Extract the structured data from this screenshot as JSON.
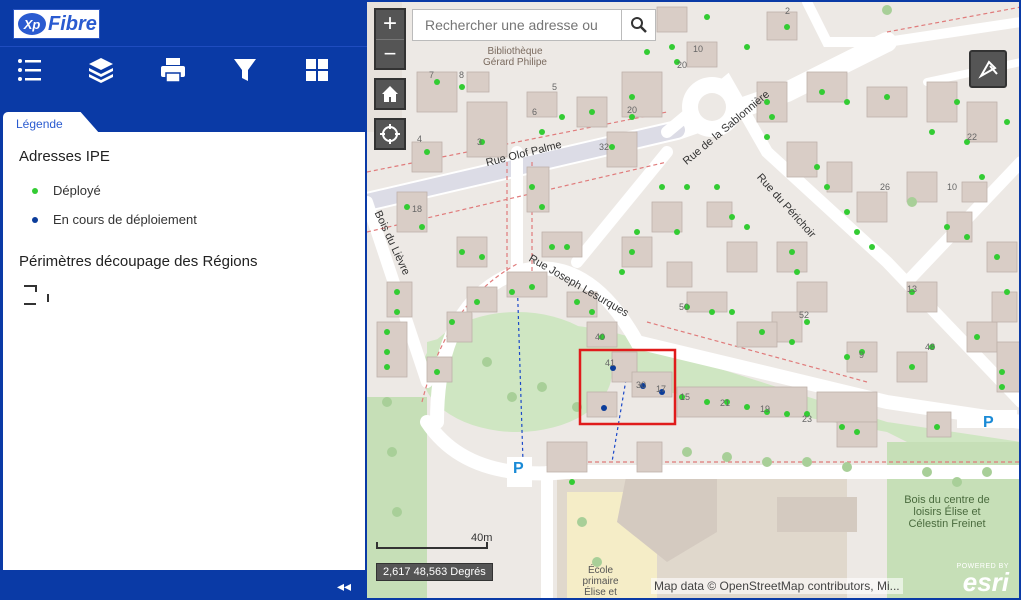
{
  "brand": {
    "logo_mark": "Xp",
    "logo_text": "Fibre"
  },
  "toolbar": {
    "items": [
      {
        "name": "list-icon"
      },
      {
        "name": "layers-icon"
      },
      {
        "name": "print-icon"
      },
      {
        "name": "filter-icon"
      },
      {
        "name": "grid-icon"
      }
    ]
  },
  "panel": {
    "tab_label": "Légende",
    "section1_title": "Adresses IPE",
    "items": [
      {
        "label": "Déployé",
        "color": "#33cc33"
      },
      {
        "label": "En cours de déploiement",
        "color": "#0b3c9a"
      }
    ],
    "section2_title": "Périmètres découpage des Régions",
    "collapse_label": "◂◂"
  },
  "map": {
    "search_placeholder": "Rechercher une adresse ou",
    "zoom_in": "+",
    "zoom_out": "−",
    "streets": {
      "olof": "Rue Olof Palme",
      "sablonniere": "Rue de la Sablonnière",
      "perichoir": "Rue du Périchoir",
      "joseph": "Rue Joseph Lesurques",
      "lievre": "Bois du Lièvre",
      "bois_centre": "Bois du centre de loisirs Élise et Célestin Freinet",
      "bibliotheque": "Bibliothèque Gérard Philipe",
      "ecole": "École primaire Élise et"
    },
    "scale_label": "40m",
    "coords": "2,617 48,563 Degrés",
    "attribution": "Map data © OpenStreetMap contributors, Mi...",
    "esri_powered": "POWERED BY",
    "esri_logo": "esri",
    "parking": "P",
    "house_numbers": [
      "7",
      "8",
      "5",
      "6",
      "4",
      "3",
      "20",
      "10",
      "32",
      "18",
      "20",
      "22",
      "2",
      "10",
      "30",
      "17",
      "15",
      "21",
      "19",
      "23",
      "26",
      "13",
      "9",
      "41",
      "50",
      "52",
      "48",
      "40"
    ]
  }
}
